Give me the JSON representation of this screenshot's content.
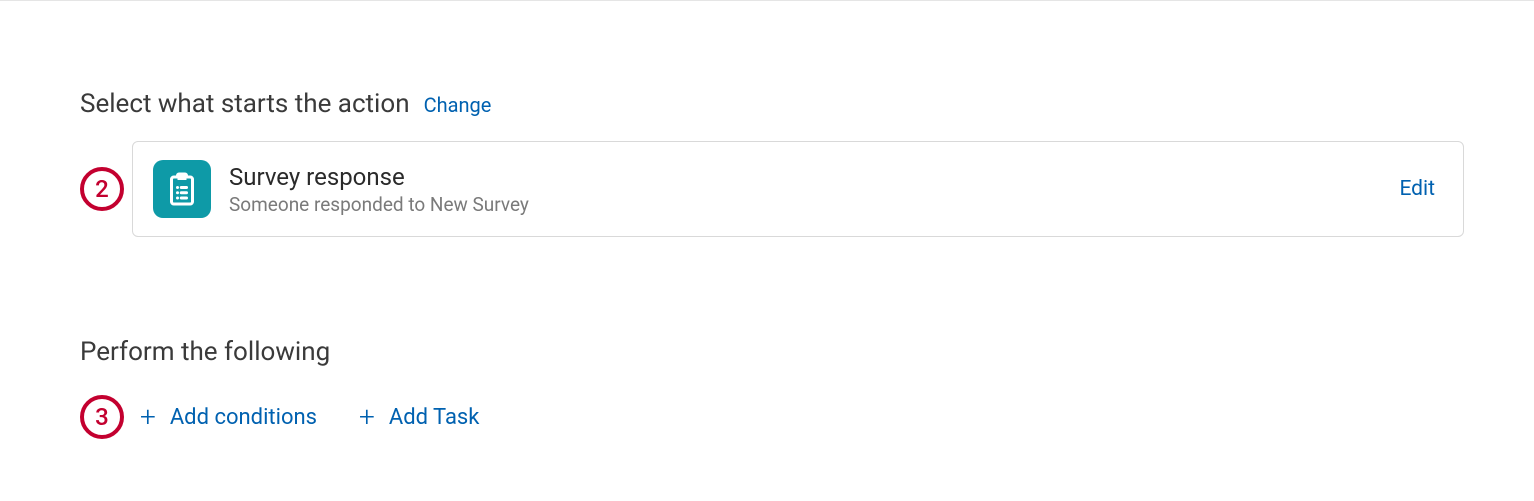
{
  "trigger_section": {
    "title": "Select what starts the action",
    "change_label": "Change",
    "step_number": "2",
    "card": {
      "title": "Survey response",
      "subtitle": "Someone responded to New Survey",
      "edit_label": "Edit"
    }
  },
  "perform_section": {
    "title": "Perform the following",
    "step_number": "3",
    "add_conditions_label": "Add conditions",
    "add_task_label": "Add Task"
  }
}
